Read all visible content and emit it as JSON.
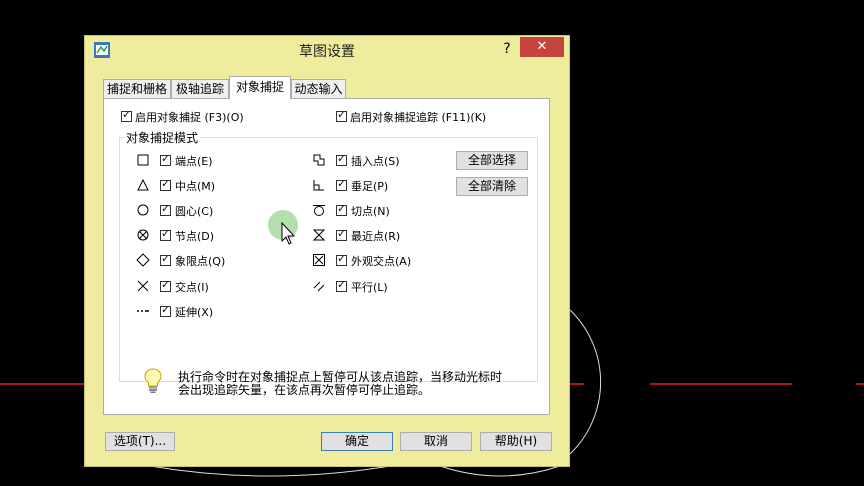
{
  "window": {
    "title": "草图设置",
    "help_label": "?",
    "close_label": "✕"
  },
  "tabs": [
    {
      "label": "捕捉和栅格",
      "active": false
    },
    {
      "label": "极轴追踪",
      "active": false
    },
    {
      "label": "对象捕捉",
      "active": true
    },
    {
      "label": "动态输入",
      "active": false
    }
  ],
  "top_options": {
    "enable_osnap": {
      "label": "启用对象捕捉 (F3)(O)",
      "checked": true
    },
    "enable_tracking": {
      "label": "启用对象捕捉追踪 (F11)(K)",
      "checked": true
    }
  },
  "modes": {
    "group_title": "对象捕捉模式",
    "left": [
      {
        "label": "端点(E)",
        "marker": "square-marker-icon",
        "checked": true
      },
      {
        "label": "中点(M)",
        "marker": "triangle-marker-icon",
        "checked": true
      },
      {
        "label": "圆心(C)",
        "marker": "circle-marker-icon",
        "checked": true
      },
      {
        "label": "节点(D)",
        "marker": "node-marker-icon",
        "checked": true
      },
      {
        "label": "象限点(Q)",
        "marker": "diamond-marker-icon",
        "checked": true
      },
      {
        "label": "交点(I)",
        "marker": "cross-marker-icon",
        "checked": true
      },
      {
        "label": "延伸(X)",
        "marker": "extension-marker-icon",
        "checked": true
      }
    ],
    "right": [
      {
        "label": "插入点(S)",
        "marker": "insertion-marker-icon",
        "checked": true
      },
      {
        "label": "垂足(P)",
        "marker": "perpendicular-marker-icon",
        "checked": true
      },
      {
        "label": "切点(N)",
        "marker": "tangent-marker-icon",
        "checked": true
      },
      {
        "label": "最近点(R)",
        "marker": "nearest-marker-icon",
        "checked": true
      },
      {
        "label": "外观交点(A)",
        "marker": "apparent-intersection-marker-icon",
        "checked": true
      },
      {
        "label": "平行(L)",
        "marker": "parallel-marker-icon",
        "checked": true
      }
    ]
  },
  "side_buttons": {
    "select_all": "全部选择",
    "clear_all": "全部清除"
  },
  "note": {
    "line1": "执行命令时在对象捕捉点上暂停可从该点追踪，当移动光标时",
    "line2": "会出现追踪矢量，在该点再次暂停可停止追踪。"
  },
  "footer": {
    "options": "选项(T)...",
    "ok": "确定",
    "cancel": "取消",
    "help": "帮助(H)"
  },
  "colors": {
    "dialog_bg": "#f0ec9e",
    "close_red": "#c7443e",
    "canvas_bg": "#000000",
    "axis_red": "#e0201a"
  }
}
